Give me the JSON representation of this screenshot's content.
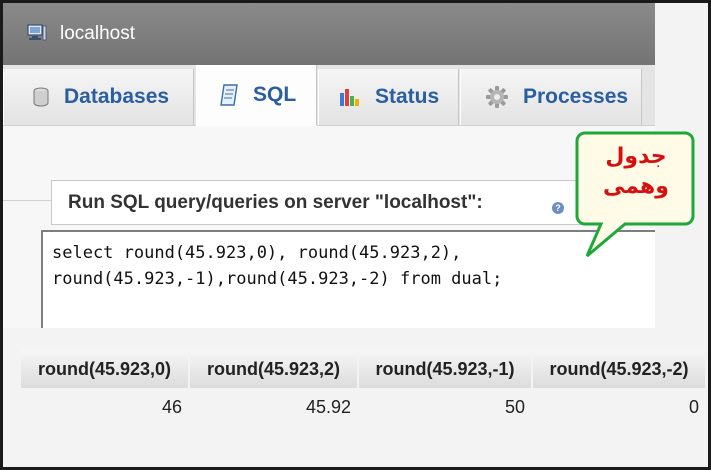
{
  "window": {
    "server_name": "localhost"
  },
  "tabs": [
    {
      "label": "Databases",
      "icon": "database-icon",
      "active": false
    },
    {
      "label": "SQL",
      "icon": "sql-document-icon",
      "active": true
    },
    {
      "label": "Status",
      "icon": "status-chart-icon",
      "active": false
    },
    {
      "label": "Processes",
      "icon": "gear-icon",
      "active": false
    }
  ],
  "query_panel": {
    "legend": "Run SQL query/queries on server \"localhost\":",
    "sql_text": "select round(45.923,0), round(45.923,2),\nround(45.923,-1),round(45.923,-2) from dual;"
  },
  "annotation": {
    "text_line1": "جدول",
    "text_line2": "وهمى",
    "color": "#d41010"
  },
  "results": {
    "columns": [
      "round(45.923,0)",
      "round(45.923,2)",
      "round(45.923,-1)",
      "round(45.923,-2)"
    ],
    "rows": [
      [
        "46",
        "45.92",
        "50",
        "0"
      ]
    ]
  }
}
